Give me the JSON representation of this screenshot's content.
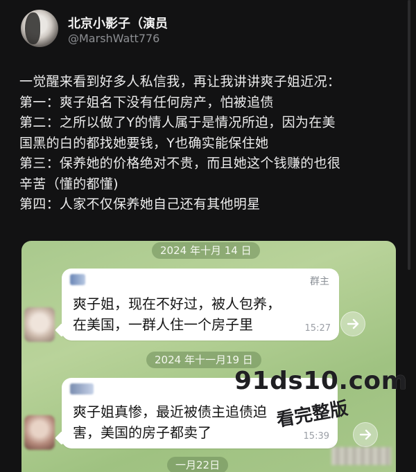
{
  "tweet": {
    "display_name": "北京小影子（演员",
    "handle": "@MarshWatt776",
    "body_lines": [
      "一觉醒来看到好多人私信我，再让我讲讲爽子姐近况：",
      "第一：爽子姐名下没有任何房产，怕被追债",
      "第二：之所以做了Y的情人属于是情况所迫，因为在美",
      "国黑的白的都找她要钱，Y也确实能保住她",
      "第三：保养她的价格绝对不贵，而且她这个钱赚的也很",
      "辛苦（懂的都懂)",
      "第四：人家不仅保养她自己还有其他明星"
    ]
  },
  "chat": {
    "messages": [
      {
        "date": "2024 年十月 14 日",
        "role": "群主",
        "lines": [
          "爽子姐，现在不好过，被人包养，",
          "在美国，一群人住一个房子里"
        ],
        "time": "15:27"
      },
      {
        "date": "2024 年十一月19 日",
        "role": "",
        "lines": [
          "爽子姐真惨，最近被债主追债迫",
          "害，美国的房子都卖了"
        ],
        "time": "15:39"
      }
    ],
    "next_date": "一月22日"
  },
  "watermark": {
    "url": "91ds10.com",
    "sub": "看完整版"
  },
  "colors": {
    "background": "#121213",
    "chat_bg": "#a9c98d",
    "bubble": "#ffffff",
    "text": "#ececec"
  },
  "icons": {
    "forward": "forward-arrow-icon",
    "avatar": "profile-avatar"
  }
}
